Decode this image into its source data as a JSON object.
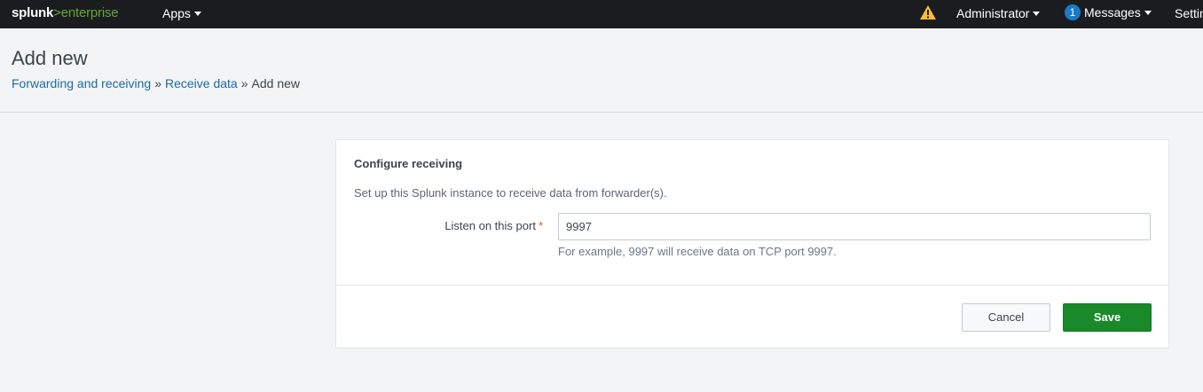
{
  "topbar": {
    "logo_brand": "splunk",
    "logo_sep": ">",
    "logo_product": "enterprise",
    "apps_label": "Apps",
    "warning_icon": "warning-triangle-icon",
    "user_label": "Administrator",
    "messages_count": "1",
    "messages_label": "Messages",
    "settings_label": "Settings"
  },
  "header": {
    "title": "Add new",
    "breadcrumb": {
      "item1": "Forwarding and receiving",
      "item2": "Receive data",
      "current": "Add new",
      "separator": "»"
    }
  },
  "form": {
    "section_title": "Configure receiving",
    "description": "Set up this Splunk instance to receive data from forwarder(s).",
    "port_label": "Listen on this port",
    "required_mark": "*",
    "port_value": "9997",
    "help_text": "For example, 9997 will receive data on TCP port 9997.",
    "cancel_label": "Cancel",
    "save_label": "Save"
  },
  "colors": {
    "topbar_bg": "#1a1c20",
    "brand_green": "#65a637",
    "link_blue": "#1e6ba0",
    "save_green": "#1a8929",
    "badge_blue": "#1a7bc4",
    "warning_yellow": "#f8be34"
  }
}
